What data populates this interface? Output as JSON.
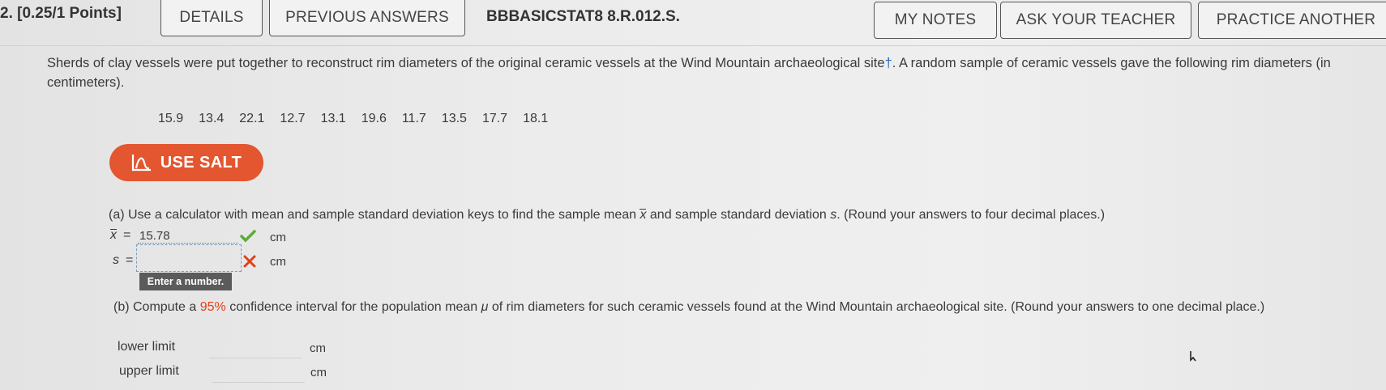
{
  "header": {
    "question_number": "2. [0.25/1 Points]",
    "tabs": {
      "details": "DETAILS",
      "previous_answers": "PREVIOUS ANSWERS",
      "my_notes": "MY NOTES",
      "ask_teacher": "ASK YOUR TEACHER",
      "practice_another": "PRACTICE ANOTHER"
    },
    "problem_code": "BBBASICSTAT8 8.R.012.S."
  },
  "problem": {
    "text_before_dagger": "Sherds of clay vessels were put together to reconstruct rim diameters of the original ceramic vessels at the Wind Mountain archaeological site",
    "dagger": "†",
    "text_after_dagger": ". A random sample of ceramic vessels gave the following rim diameters (in centimeters).",
    "data": [
      "15.9",
      "13.4",
      "22.1",
      "12.7",
      "13.1",
      "19.6",
      "11.7",
      "13.5",
      "17.7",
      "18.1"
    ]
  },
  "salt_button": {
    "label": "USE SALT",
    "icon": "salt-chart-icon",
    "color": "#e3562f"
  },
  "part_a": {
    "text_prefix": "(a) Use a calculator with mean and sample standard deviation keys to find the sample mean ",
    "xbar_symbol": "x",
    "text_middle": " and sample standard deviation ",
    "s_symbol": "s",
    "text_suffix": ". (Round your answers to four decimal places.)",
    "mean_label": "x",
    "equals": "=",
    "mean_value": "15.78",
    "mean_unit": "cm",
    "mean_status": "correct",
    "sd_label": "s",
    "sd_value": "",
    "sd_unit": "cm",
    "sd_status": "incorrect",
    "tooltip": "Enter a number."
  },
  "part_b": {
    "text_prefix": "(b) Compute a ",
    "highlight": "95%",
    "text_middle": " confidence interval for the population mean ",
    "mu_symbol": "μ",
    "text_suffix": " of rim diameters for such ceramic vessels found at the Wind Mountain archaeological site. (Round your answers to one decimal place.)",
    "lower_label": "lower limit",
    "lower_unit": "cm",
    "lower_value": "",
    "upper_label": "upper limit",
    "upper_unit": "cm",
    "upper_value": ""
  },
  "colors": {
    "correct": "#5cab3a",
    "incorrect": "#e0401a",
    "accent": "#e3562f",
    "dagger": "#2a64c4"
  }
}
